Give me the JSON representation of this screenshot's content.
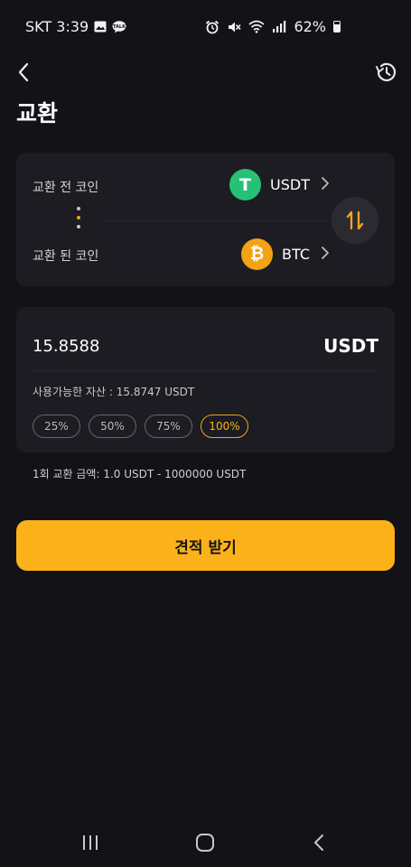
{
  "status_bar": {
    "carrier_time": "SKT 3:39",
    "battery": "62%",
    "left_icons": [
      "gallery-icon",
      "chat-notification-icon"
    ],
    "right_icons": [
      "alarm-icon",
      "mute-icon",
      "wifi-icon",
      "signal-icon",
      "battery-icon"
    ]
  },
  "header": {
    "title": "교환",
    "back_icon": "chevron-left-icon",
    "history_icon": "history-icon"
  },
  "swap_card": {
    "from_label": "교환 전 코인",
    "from_coin": "USDT",
    "from_coin_symbol": "T",
    "from_coin_color": "#26c177",
    "to_label": "교환 된 코인",
    "to_coin": "BTC",
    "to_coin_symbol": "₿",
    "to_coin_color": "#f3a213",
    "swap_icon": "swap-arrows-icon"
  },
  "amount_card": {
    "amount": "15.8588",
    "unit": "USDT",
    "available": "사용가능한 자산 : 15.8747 USDT",
    "percent_options": [
      "25%",
      "50%",
      "75%",
      "100%"
    ],
    "selected_percent": "100%"
  },
  "range_note": "1회 교환 금액: 1.0 USDT  -  1000000 USDT",
  "quote_button": "견적 받기",
  "colors": {
    "background": "#131217",
    "card": "#1d1c22",
    "accent": "#fbb11a"
  },
  "system_nav": [
    "recent-apps-icon",
    "home-icon",
    "back-icon"
  ]
}
